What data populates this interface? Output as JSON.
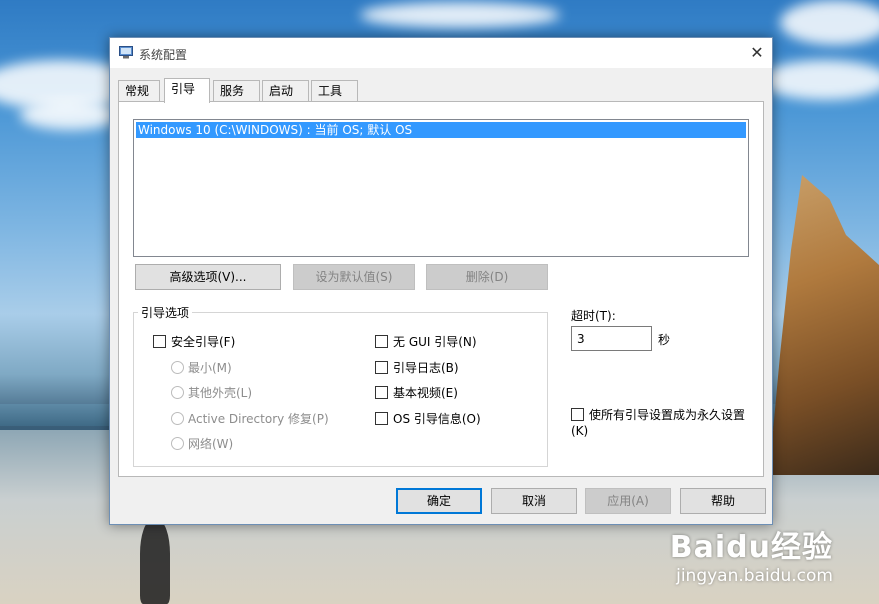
{
  "window": {
    "title": "系统配置",
    "close_glyph": "✕"
  },
  "tabs": [
    "常规",
    "引导",
    "服务",
    "启动",
    "工具"
  ],
  "active_tab": "引导",
  "os_list": {
    "items": [
      "Windows 10 (C:\\WINDOWS) : 当前 OS; 默认 OS"
    ],
    "selected_index": 0
  },
  "buttons": {
    "advanced": "高级选项(V)...",
    "set_default": "设为默认值(S)",
    "delete": "删除(D)"
  },
  "boot_options": {
    "group_title": "引导选项",
    "safe_boot": "安全引导(F)",
    "minimal": "最小(M)",
    "alternate_shell": "其他外壳(L)",
    "ad_repair": "Active Directory 修复(P)",
    "network": "网络(W)",
    "no_gui_boot": "无 GUI 引导(N)",
    "boot_log": "引导日志(B)",
    "base_video": "基本视频(E)",
    "os_boot_info": "OS 引导信息(O)"
  },
  "timeout": {
    "label": "超时(T):",
    "value": "3",
    "unit": "秒"
  },
  "permanent": {
    "label": "使所有引导设置成为永久设置(K)"
  },
  "footer": {
    "ok": "确定",
    "cancel": "取消",
    "apply": "应用(A)",
    "help": "帮助"
  },
  "watermark": {
    "logo": "Baidu经验",
    "url": "jingyan.baidu.com"
  },
  "colors": {
    "selection": "#3399ff",
    "default_button_border": "#0078d7"
  }
}
